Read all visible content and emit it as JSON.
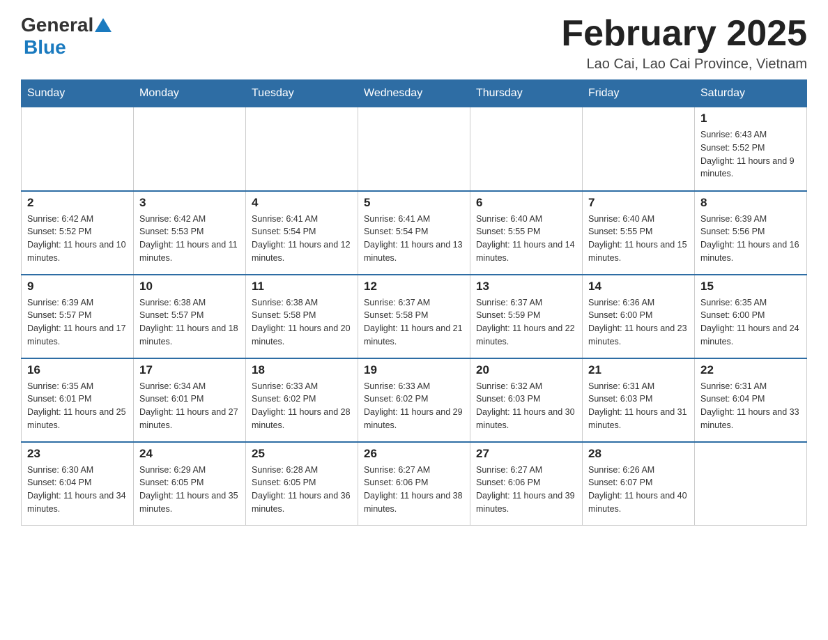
{
  "header": {
    "logo_general": "General",
    "logo_blue": "Blue",
    "title": "February 2025",
    "location": "Lao Cai, Lao Cai Province, Vietnam"
  },
  "weekdays": [
    "Sunday",
    "Monday",
    "Tuesday",
    "Wednesday",
    "Thursday",
    "Friday",
    "Saturday"
  ],
  "weeks": [
    [
      {
        "day": "",
        "info": ""
      },
      {
        "day": "",
        "info": ""
      },
      {
        "day": "",
        "info": ""
      },
      {
        "day": "",
        "info": ""
      },
      {
        "day": "",
        "info": ""
      },
      {
        "day": "",
        "info": ""
      },
      {
        "day": "1",
        "info": "Sunrise: 6:43 AM\nSunset: 5:52 PM\nDaylight: 11 hours and 9 minutes."
      }
    ],
    [
      {
        "day": "2",
        "info": "Sunrise: 6:42 AM\nSunset: 5:52 PM\nDaylight: 11 hours and 10 minutes."
      },
      {
        "day": "3",
        "info": "Sunrise: 6:42 AM\nSunset: 5:53 PM\nDaylight: 11 hours and 11 minutes."
      },
      {
        "day": "4",
        "info": "Sunrise: 6:41 AM\nSunset: 5:54 PM\nDaylight: 11 hours and 12 minutes."
      },
      {
        "day": "5",
        "info": "Sunrise: 6:41 AM\nSunset: 5:54 PM\nDaylight: 11 hours and 13 minutes."
      },
      {
        "day": "6",
        "info": "Sunrise: 6:40 AM\nSunset: 5:55 PM\nDaylight: 11 hours and 14 minutes."
      },
      {
        "day": "7",
        "info": "Sunrise: 6:40 AM\nSunset: 5:55 PM\nDaylight: 11 hours and 15 minutes."
      },
      {
        "day": "8",
        "info": "Sunrise: 6:39 AM\nSunset: 5:56 PM\nDaylight: 11 hours and 16 minutes."
      }
    ],
    [
      {
        "day": "9",
        "info": "Sunrise: 6:39 AM\nSunset: 5:57 PM\nDaylight: 11 hours and 17 minutes."
      },
      {
        "day": "10",
        "info": "Sunrise: 6:38 AM\nSunset: 5:57 PM\nDaylight: 11 hours and 18 minutes."
      },
      {
        "day": "11",
        "info": "Sunrise: 6:38 AM\nSunset: 5:58 PM\nDaylight: 11 hours and 20 minutes."
      },
      {
        "day": "12",
        "info": "Sunrise: 6:37 AM\nSunset: 5:58 PM\nDaylight: 11 hours and 21 minutes."
      },
      {
        "day": "13",
        "info": "Sunrise: 6:37 AM\nSunset: 5:59 PM\nDaylight: 11 hours and 22 minutes."
      },
      {
        "day": "14",
        "info": "Sunrise: 6:36 AM\nSunset: 6:00 PM\nDaylight: 11 hours and 23 minutes."
      },
      {
        "day": "15",
        "info": "Sunrise: 6:35 AM\nSunset: 6:00 PM\nDaylight: 11 hours and 24 minutes."
      }
    ],
    [
      {
        "day": "16",
        "info": "Sunrise: 6:35 AM\nSunset: 6:01 PM\nDaylight: 11 hours and 25 minutes."
      },
      {
        "day": "17",
        "info": "Sunrise: 6:34 AM\nSunset: 6:01 PM\nDaylight: 11 hours and 27 minutes."
      },
      {
        "day": "18",
        "info": "Sunrise: 6:33 AM\nSunset: 6:02 PM\nDaylight: 11 hours and 28 minutes."
      },
      {
        "day": "19",
        "info": "Sunrise: 6:33 AM\nSunset: 6:02 PM\nDaylight: 11 hours and 29 minutes."
      },
      {
        "day": "20",
        "info": "Sunrise: 6:32 AM\nSunset: 6:03 PM\nDaylight: 11 hours and 30 minutes."
      },
      {
        "day": "21",
        "info": "Sunrise: 6:31 AM\nSunset: 6:03 PM\nDaylight: 11 hours and 31 minutes."
      },
      {
        "day": "22",
        "info": "Sunrise: 6:31 AM\nSunset: 6:04 PM\nDaylight: 11 hours and 33 minutes."
      }
    ],
    [
      {
        "day": "23",
        "info": "Sunrise: 6:30 AM\nSunset: 6:04 PM\nDaylight: 11 hours and 34 minutes."
      },
      {
        "day": "24",
        "info": "Sunrise: 6:29 AM\nSunset: 6:05 PM\nDaylight: 11 hours and 35 minutes."
      },
      {
        "day": "25",
        "info": "Sunrise: 6:28 AM\nSunset: 6:05 PM\nDaylight: 11 hours and 36 minutes."
      },
      {
        "day": "26",
        "info": "Sunrise: 6:27 AM\nSunset: 6:06 PM\nDaylight: 11 hours and 38 minutes."
      },
      {
        "day": "27",
        "info": "Sunrise: 6:27 AM\nSunset: 6:06 PM\nDaylight: 11 hours and 39 minutes."
      },
      {
        "day": "28",
        "info": "Sunrise: 6:26 AM\nSunset: 6:07 PM\nDaylight: 11 hours and 40 minutes."
      },
      {
        "day": "",
        "info": ""
      }
    ]
  ]
}
